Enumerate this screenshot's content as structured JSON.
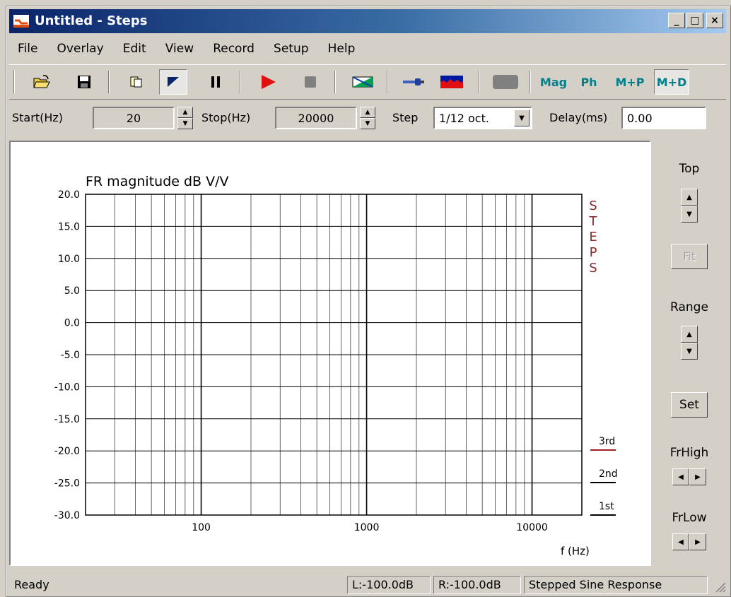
{
  "window": {
    "title": "Untitled - Steps",
    "min_glyph": "_",
    "max_glyph": "□",
    "close_glyph": "×"
  },
  "menu": [
    "File",
    "Overlay",
    "Edit",
    "View",
    "Record",
    "Setup",
    "Help"
  ],
  "toolbar": {
    "icons": [
      "open-folder-icon",
      "save-disk-icon",
      "copy-icon",
      "mode-icon",
      "pause-icon",
      "play-icon",
      "stop-icon",
      "sweep-icon",
      "probe-icon",
      "spectrum-icon",
      "blank-icon"
    ],
    "view_buttons": [
      "Mag",
      "Ph",
      "M+P",
      "M+D"
    ],
    "active_view": "M+D"
  },
  "params": {
    "start_label": "Start(Hz)",
    "start_value": "20",
    "stop_label": "Stop(Hz)",
    "stop_value": "20000",
    "step_label": "Step",
    "step_value": "1/12 oct.",
    "delay_label": "Delay(ms)",
    "delay_value": "0.00"
  },
  "right_panel": {
    "top_label": "Top",
    "fit_label": "Fit",
    "range_label": "Range",
    "set_label": "Set",
    "frhigh_label": "FrHigh",
    "frlow_label": "FrLow"
  },
  "status": {
    "message": "Ready",
    "left_level": "L:-100.0dB",
    "right_level": "R:-100.0dB",
    "mode": "Stepped Sine Response"
  },
  "chart_data": {
    "type": "line",
    "title": "FR magnitude dB V/V",
    "xlabel": "f (Hz)",
    "ylabel": "",
    "x_scale": "log",
    "xlim": [
      20,
      20000
    ],
    "ylim": [
      -30,
      20
    ],
    "y_ticks": [
      "20.0",
      "15.0",
      "10.0",
      "5.0",
      "0.0",
      "-5.0",
      "-10.0",
      "-15.0",
      "-20.0",
      "-25.0",
      "-30.0"
    ],
    "x_ticks": [
      "100",
      "1000",
      "10000"
    ],
    "grid": true,
    "side_text": [
      "S",
      "T",
      "E",
      "P",
      "S"
    ],
    "legend": [
      {
        "name": "3rd",
        "color": "#a02020"
      },
      {
        "name": "2nd",
        "color": "#000000"
      },
      {
        "name": "1st",
        "color": "#000000"
      }
    ],
    "series": []
  }
}
